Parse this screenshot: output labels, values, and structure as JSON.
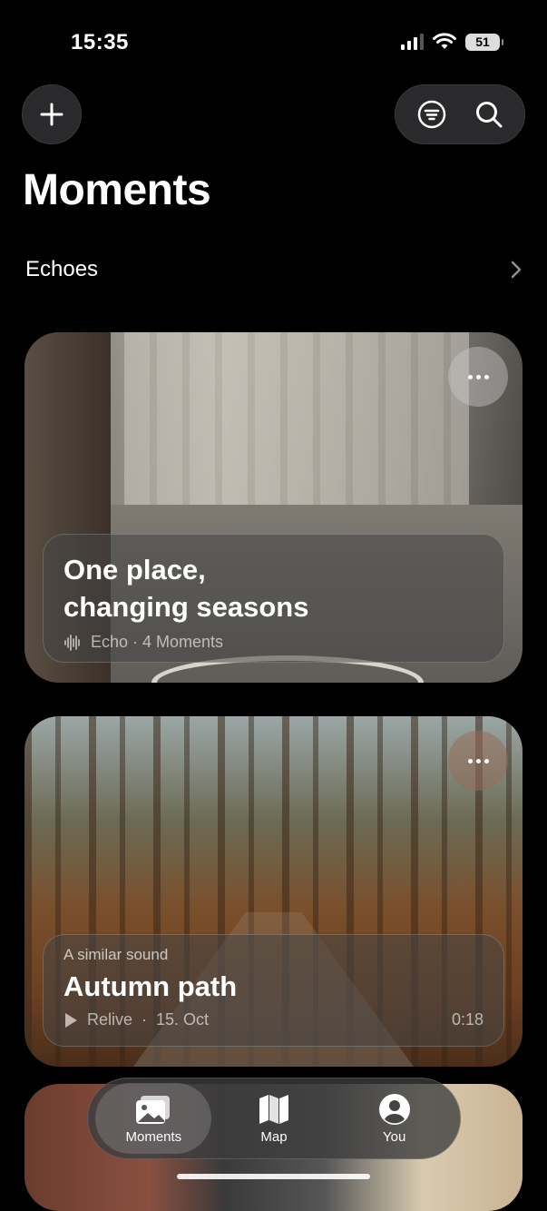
{
  "status_bar": {
    "time": "15:35",
    "battery": "51"
  },
  "header": {
    "title": "Moments"
  },
  "section": {
    "title": "Echoes"
  },
  "cards": [
    {
      "title_line1": "One place,",
      "title_line2": "changing seasons",
      "meta": "Echo · 4 Moments",
      "icon": "waveform-icon"
    },
    {
      "eyebrow": "A similar sound",
      "title": "Autumn path",
      "action": "Relive",
      "date": "15. Oct",
      "duration": "0:18",
      "icon": "play-icon"
    }
  ],
  "tabbar": {
    "tabs": [
      {
        "label": "Moments",
        "icon": "photos-icon",
        "active": true
      },
      {
        "label": "Map",
        "icon": "map-icon",
        "active": false
      },
      {
        "label": "You",
        "icon": "person-icon",
        "active": false
      }
    ]
  },
  "colors": {
    "background": "#000000",
    "glass": "#464646",
    "text": "#ffffff"
  }
}
